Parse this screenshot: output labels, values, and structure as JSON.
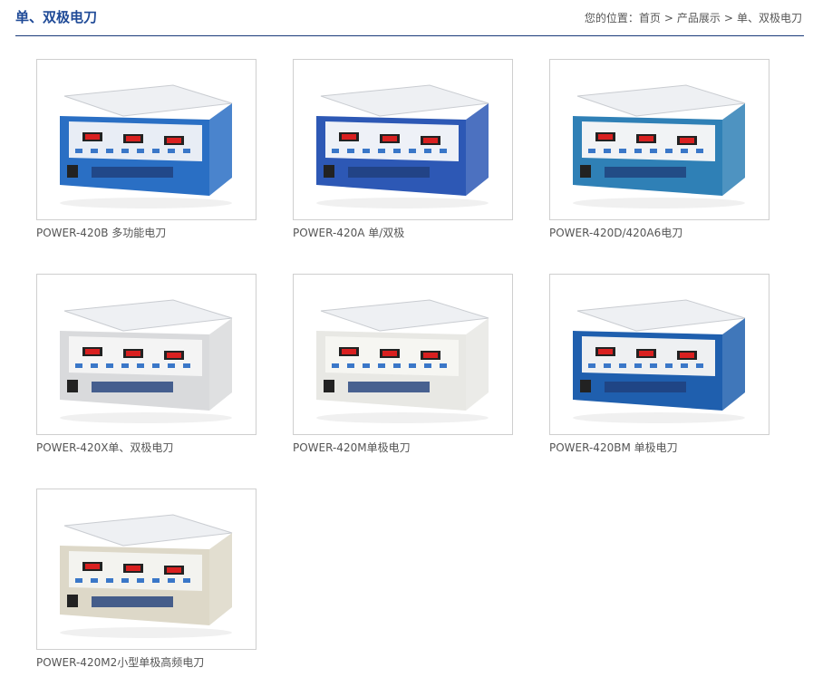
{
  "header": {
    "title": "单、双极电刀",
    "breadcrumb": {
      "prefix": "您的位置：",
      "items": [
        "首页",
        "产品展示",
        "单、双极电刀"
      ],
      "separator": ">"
    }
  },
  "products": [
    {
      "caption": "POWER-420B 多功能电刀",
      "body_color": "#2a6fc4",
      "panel_color": "#e8edf5"
    },
    {
      "caption": "POWER-420A 单/双极",
      "body_color": "#2d58b5",
      "panel_color": "#eef1f7"
    },
    {
      "caption": "POWER-420D/420A6电刀",
      "body_color": "#2f80b6",
      "panel_color": "#f1f3f5"
    },
    {
      "caption": "POWER-420X单、双极电刀",
      "body_color": "#d9dadc",
      "panel_color": "#f4f4f4"
    },
    {
      "caption": "POWER-420M单极电刀",
      "body_color": "#e8e8e4",
      "panel_color": "#f6f6f2"
    },
    {
      "caption": "POWER-420BM 单极电刀",
      "body_color": "#1f5fae",
      "panel_color": "#eef0f2"
    },
    {
      "caption": "POWER-420M2小型单极高频电刀",
      "body_color": "#ddd8c8",
      "panel_color": "#f3f3ef"
    }
  ]
}
